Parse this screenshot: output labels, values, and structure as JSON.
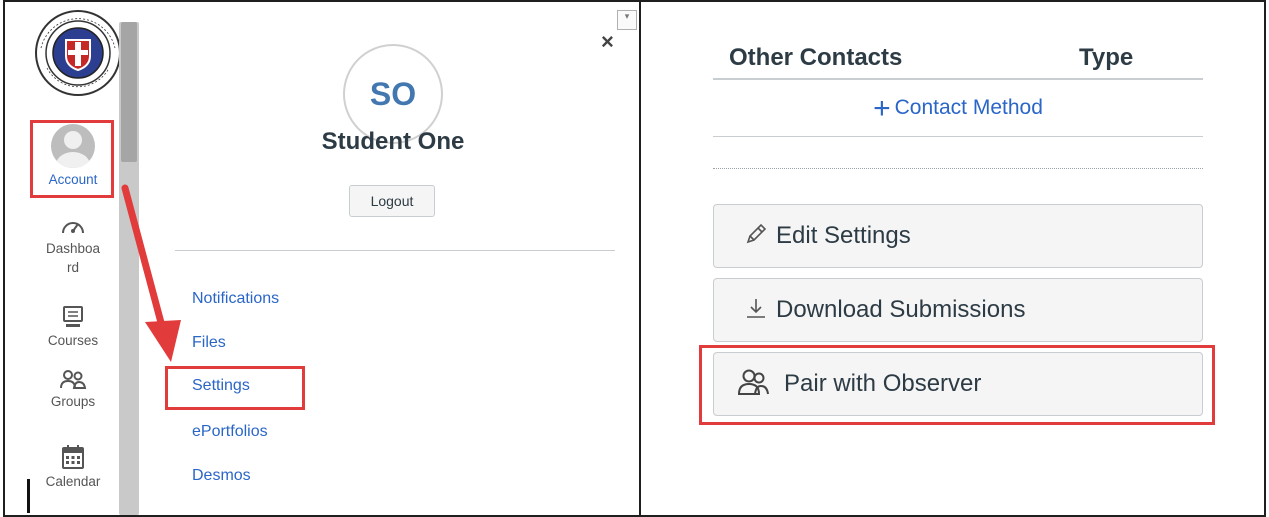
{
  "account_tray": {
    "avatar_initials": "SO",
    "user_name": "Student One",
    "logout_label": "Logout",
    "close_glyph": "×",
    "links": [
      {
        "label": "Notifications"
      },
      {
        "label": "Files"
      },
      {
        "label": "Settings",
        "highlighted": true
      },
      {
        "label": "ePortfolios"
      },
      {
        "label": "Desmos"
      }
    ]
  },
  "global_nav": {
    "items": [
      {
        "label": "Account",
        "icon": "user-avatar-icon",
        "highlighted": true
      },
      {
        "label": "Dashboa\nrd",
        "icon": "dashboard-gauge-icon"
      },
      {
        "label": "Courses",
        "icon": "courses-monitor-icon"
      },
      {
        "label": "Groups",
        "icon": "groups-people-icon"
      },
      {
        "label": "Calendar",
        "icon": "calendar-icon"
      }
    ],
    "logo_text": "LUNENBURG COUNTY"
  },
  "contacts": {
    "header_other": "Other Contacts",
    "header_type": "Type",
    "add_label": "Contact Method",
    "add_icon": "plus-icon"
  },
  "sidebar_buttons": {
    "edit_settings": {
      "label": "Edit Settings",
      "icon": "pencil-icon"
    },
    "download_submissions": {
      "label": "Download Submissions",
      "icon": "download-icon"
    },
    "pair_observer": {
      "label": "Pair with Observer",
      "icon": "observer-people-icon",
      "highlighted": true
    }
  },
  "colors": {
    "link_blue": "#2a66c7",
    "highlight_red": "#e23b3b",
    "text_dark": "#2d3b45",
    "button_bg": "#f5f5f5"
  }
}
